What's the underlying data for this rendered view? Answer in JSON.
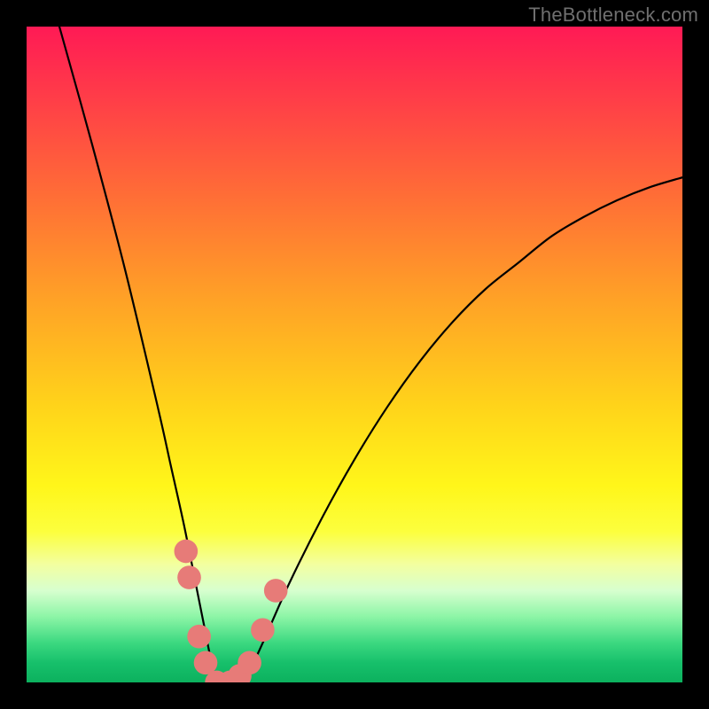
{
  "watermark": "TheBottleneck.com",
  "chart_data": {
    "type": "line",
    "title": "",
    "xlabel": "",
    "ylabel": "",
    "xlim": [
      0,
      100
    ],
    "ylim": [
      0,
      100
    ],
    "grid": false,
    "series": [
      {
        "name": "bottleneck-curve",
        "x": [
          5,
          10,
          15,
          20,
          22,
          24,
          26,
          27,
          28,
          29,
          30,
          32,
          34,
          36,
          40,
          45,
          50,
          55,
          60,
          65,
          70,
          75,
          80,
          85,
          90,
          95,
          100
        ],
        "y": [
          100,
          82,
          63,
          42,
          33,
          24,
          14,
          9,
          4,
          0,
          0,
          0,
          2,
          6,
          15,
          25,
          34,
          42,
          49,
          55,
          60,
          64,
          68,
          71,
          73.5,
          75.5,
          77
        ]
      }
    ],
    "markers": [
      {
        "name": "dot",
        "x": 24.3,
        "y": 20,
        "r": 1.8
      },
      {
        "name": "dot",
        "x": 24.8,
        "y": 16,
        "r": 1.8
      },
      {
        "name": "dot",
        "x": 26.3,
        "y": 7,
        "r": 1.8
      },
      {
        "name": "dot",
        "x": 27.3,
        "y": 3,
        "r": 1.8
      },
      {
        "name": "dot",
        "x": 29.0,
        "y": 0,
        "r": 1.8
      },
      {
        "name": "dot",
        "x": 31.0,
        "y": 0,
        "r": 1.8
      },
      {
        "name": "dot",
        "x": 32.5,
        "y": 1,
        "r": 1.8
      },
      {
        "name": "dot",
        "x": 34.0,
        "y": 3,
        "r": 1.8
      },
      {
        "name": "dot",
        "x": 36.0,
        "y": 8,
        "r": 1.8
      },
      {
        "name": "dot",
        "x": 38.0,
        "y": 14,
        "r": 1.8
      }
    ],
    "gradient_stops": [
      {
        "pct": 0,
        "color": "#ff1a55"
      },
      {
        "pct": 40,
        "color": "#ffa326"
      },
      {
        "pct": 70,
        "color": "#fff61a"
      },
      {
        "pct": 90,
        "color": "#8cf5a6"
      },
      {
        "pct": 100,
        "color": "#0cb15e"
      }
    ]
  }
}
